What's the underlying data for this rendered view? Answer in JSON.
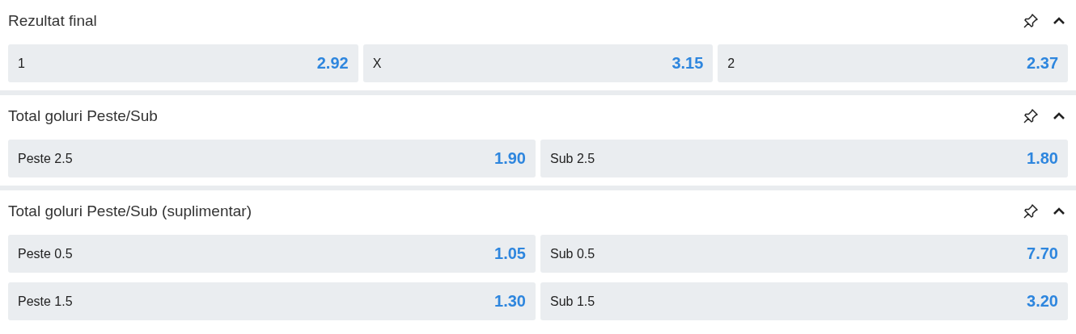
{
  "markets": [
    {
      "title": "Rezultat final",
      "expanded": true,
      "rows": [
        [
          {
            "label": "1",
            "odds": "2.92"
          },
          {
            "label": "X",
            "odds": "3.15"
          },
          {
            "label": "2",
            "odds": "2.37"
          }
        ]
      ]
    },
    {
      "title": "Total goluri Peste/Sub",
      "expanded": true,
      "rows": [
        [
          {
            "label": "Peste 2.5",
            "odds": "1.90"
          },
          {
            "label": "Sub 2.5",
            "odds": "1.80"
          }
        ]
      ]
    },
    {
      "title": "Total goluri Peste/Sub (suplimentar)",
      "expanded": true,
      "rows": [
        [
          {
            "label": "Peste 0.5",
            "odds": "1.05"
          },
          {
            "label": "Sub 0.5",
            "odds": "7.70"
          }
        ],
        [
          {
            "label": "Peste 1.5",
            "odds": "1.30"
          },
          {
            "label": "Sub 1.5",
            "odds": "3.20"
          }
        ]
      ]
    }
  ]
}
